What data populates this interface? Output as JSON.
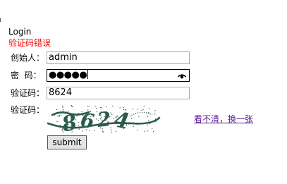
{
  "page": {
    "title": "Login",
    "error_message": "验证码错误"
  },
  "form": {
    "username": {
      "label": "创始人：",
      "value": "admin"
    },
    "password": {
      "label": "密  码：",
      "masked_value": "●●●●●",
      "reveal_icon": "eye-icon"
    },
    "captcha_input": {
      "label": "验证码：",
      "value": "8624"
    },
    "captcha_image": {
      "label": "验证码：",
      "text": "8624",
      "color": "#2b5c4a"
    },
    "refresh_link": "看不清，换一张",
    "submit_label": "submit"
  },
  "colors": {
    "error": "#ff0000",
    "link_visited": "#551a8b"
  }
}
